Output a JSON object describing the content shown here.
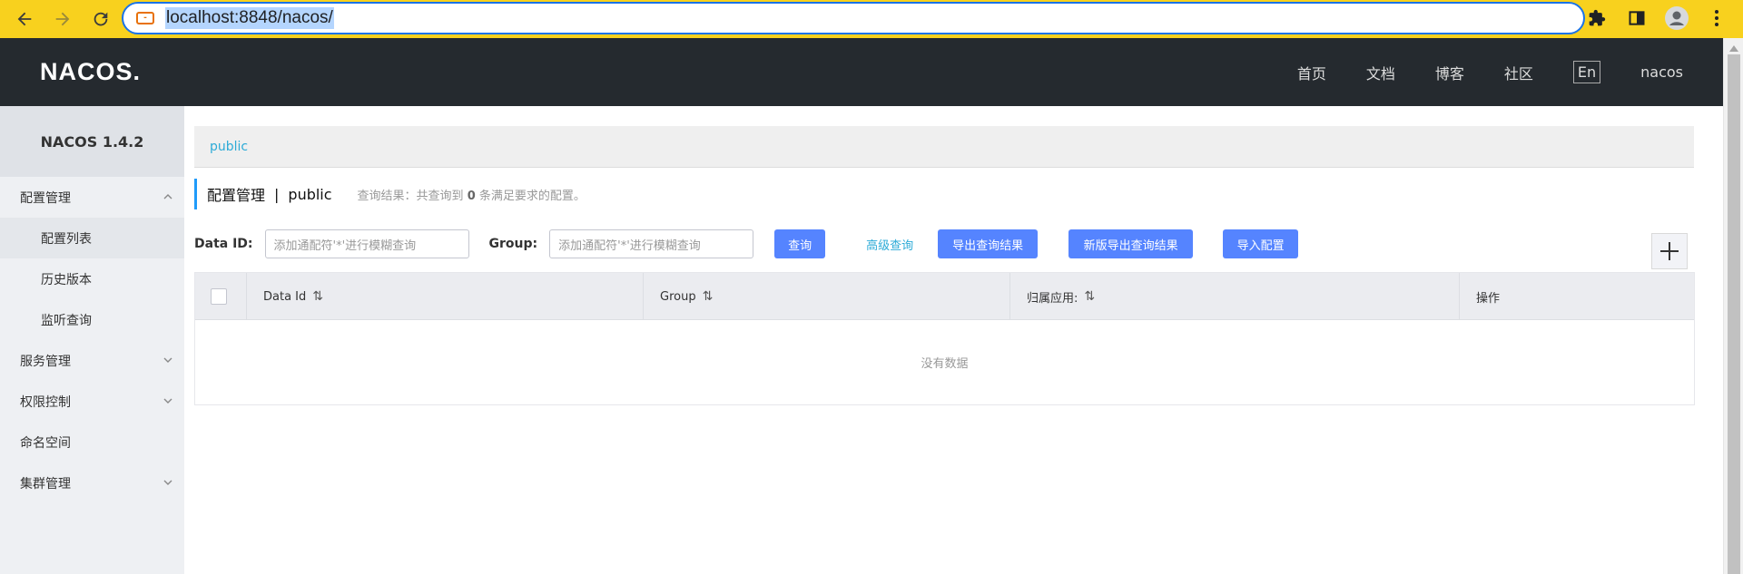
{
  "browser": {
    "url": "localhost:8848/nacos/",
    "back_icon": "back-arrow-icon",
    "forward_icon": "forward-arrow-icon",
    "reload_icon": "reload-icon"
  },
  "header": {
    "logo": "NACOS.",
    "nav": [
      "首页",
      "文档",
      "博客",
      "社区"
    ],
    "lang": "En",
    "user": "nacos"
  },
  "sidebar": {
    "version": "NACOS 1.4.2",
    "items": [
      {
        "label": "配置管理",
        "expanded": true
      },
      {
        "label": "配置列表",
        "sub": true,
        "active": true
      },
      {
        "label": "历史版本",
        "sub": true
      },
      {
        "label": "监听查询",
        "sub": true
      },
      {
        "label": "服务管理",
        "expanded": false
      },
      {
        "label": "权限控制",
        "expanded": false
      },
      {
        "label": "命名空间"
      },
      {
        "label": "集群管理",
        "expanded": false
      }
    ]
  },
  "main": {
    "namespace_tab": "public",
    "title": "配置管理",
    "separator": "|",
    "namespace": "public",
    "summary_prefix": "查询结果：共查询到",
    "summary_count": "0",
    "summary_suffix": "条满足要求的配置。",
    "search": {
      "data_id_label": "Data ID:",
      "data_id_placeholder": "添加通配符'*'进行模糊查询",
      "group_label": "Group:",
      "group_placeholder": "添加通配符'*'进行模糊查询",
      "query_btn": "查询",
      "advanced_link": "高级查询",
      "export_btn": "导出查询结果",
      "export_new_btn": "新版导出查询结果",
      "import_btn": "导入配置"
    },
    "table": {
      "columns": [
        "Data Id",
        "Group",
        "归属应用:",
        "操作"
      ],
      "empty_text": "没有数据"
    }
  },
  "colors": {
    "chrome": "#f8d11e",
    "header": "#252a2f",
    "primary_button": "#5584ff",
    "link": "#2dabd7"
  }
}
